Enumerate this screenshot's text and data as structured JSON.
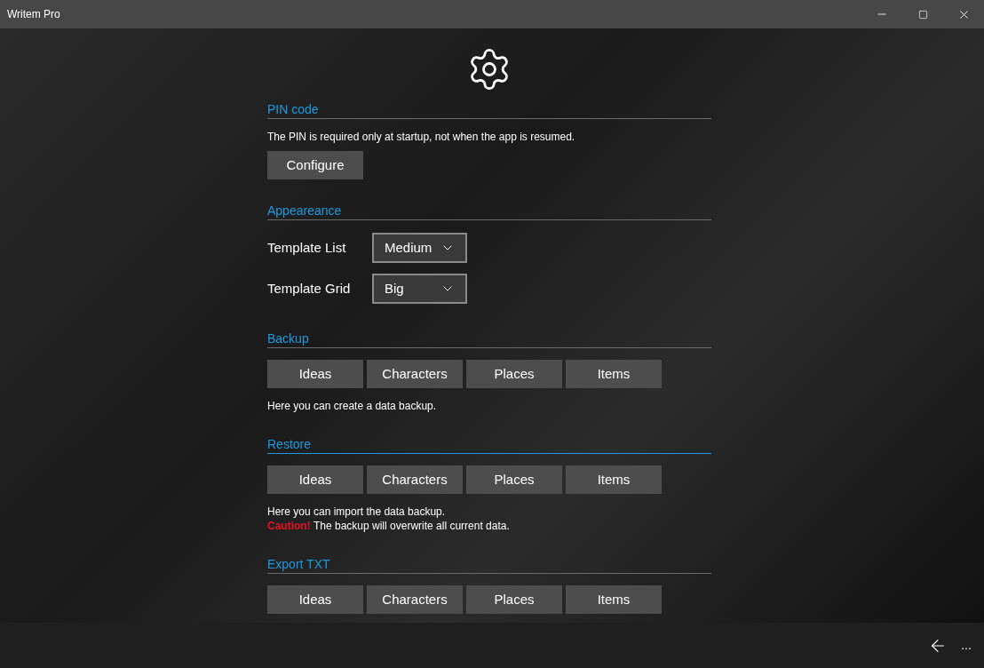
{
  "window": {
    "title": "Writem Pro"
  },
  "sections": [
    {
      "kind": "text_button",
      "title": "PIN code",
      "highlighted": false,
      "notes": [
        {
          "text": "The PIN is required only at startup, not when the app is resumed."
        }
      ],
      "button": "Configure"
    },
    {
      "kind": "dropdowns",
      "title": "Appeareance",
      "highlighted": false,
      "dropdowns": [
        {
          "label": "Template List",
          "value": "Medium"
        },
        {
          "label": "Template Grid",
          "value": "Big"
        }
      ]
    },
    {
      "kind": "buttons",
      "title": "Backup",
      "highlighted": false,
      "buttons": [
        "Ideas",
        "Characters",
        "Places",
        "Items"
      ],
      "notes": [
        {
          "text": "Here you can create a data backup."
        }
      ]
    },
    {
      "kind": "buttons",
      "title": "Restore",
      "highlighted": true,
      "buttons": [
        "Ideas",
        "Characters",
        "Places",
        "Items"
      ],
      "notes": [
        {
          "text": "Here you can import the data backup."
        },
        {
          "caution": "Caution!",
          "text": "The backup will overwrite all current data."
        }
      ]
    },
    {
      "kind": "buttons",
      "title": "Export TXT",
      "highlighted": false,
      "buttons": [
        "Ideas",
        "Characters",
        "Places",
        "Items"
      ]
    }
  ],
  "app_bar": {
    "more": "..."
  }
}
